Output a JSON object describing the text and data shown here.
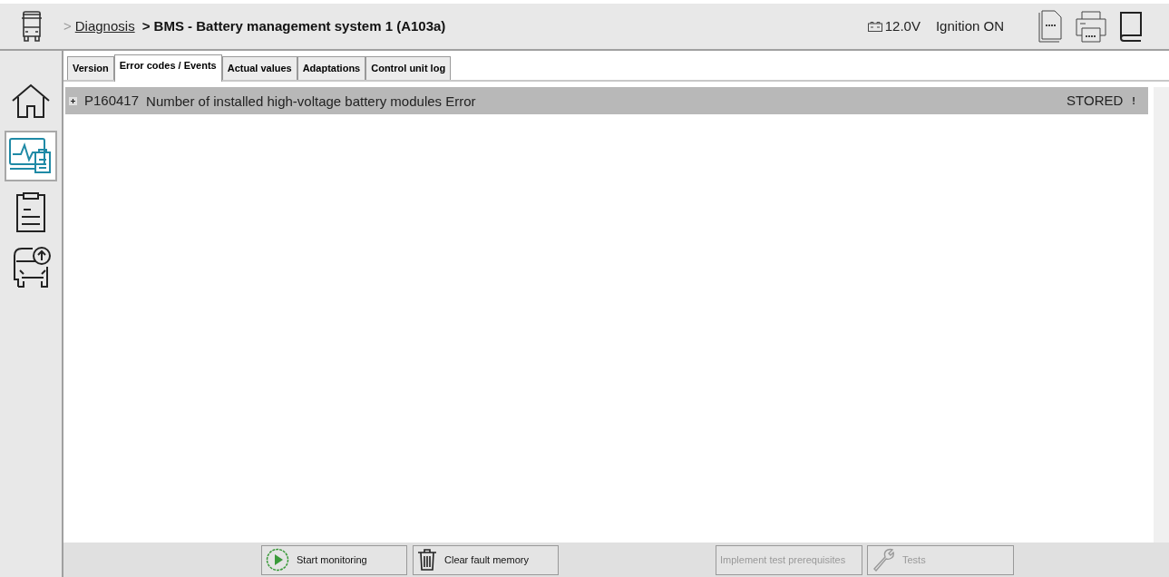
{
  "header": {
    "breadcrumb_link": "Diagnosis",
    "breadcrumb_title": "> BMS - Battery management system 1 (A103a)",
    "separator": ">",
    "voltage": "12.0V",
    "ignition": "Ignition ON"
  },
  "sidebar": {
    "items": [
      {
        "kind": "home",
        "selected": false
      },
      {
        "kind": "diagnosis",
        "selected": true
      },
      {
        "kind": "clipboard",
        "selected": false
      },
      {
        "kind": "vehicle-update",
        "selected": false
      }
    ]
  },
  "tabs": [
    {
      "label": "Version",
      "selected": false
    },
    {
      "label": "Error codes / Events",
      "selected": true
    },
    {
      "label": "Actual values",
      "selected": false
    },
    {
      "label": "Adaptations",
      "selected": false
    },
    {
      "label": "Control unit log",
      "selected": false
    }
  ],
  "faults": [
    {
      "code": "P160417",
      "description": "Number of installed high-voltage battery modules Error",
      "status": "STORED",
      "expanded": false,
      "mark": "!"
    }
  ],
  "buttons": [
    {
      "kind": "play",
      "label": "Start monitoring",
      "disabled": false
    },
    {
      "kind": "trash",
      "label": "Clear fault memory",
      "disabled": false
    },
    {
      "kind": "none",
      "label": "Implement test prerequisites",
      "disabled": true
    },
    {
      "kind": "wrench",
      "label": "Tests",
      "disabled": true
    }
  ]
}
